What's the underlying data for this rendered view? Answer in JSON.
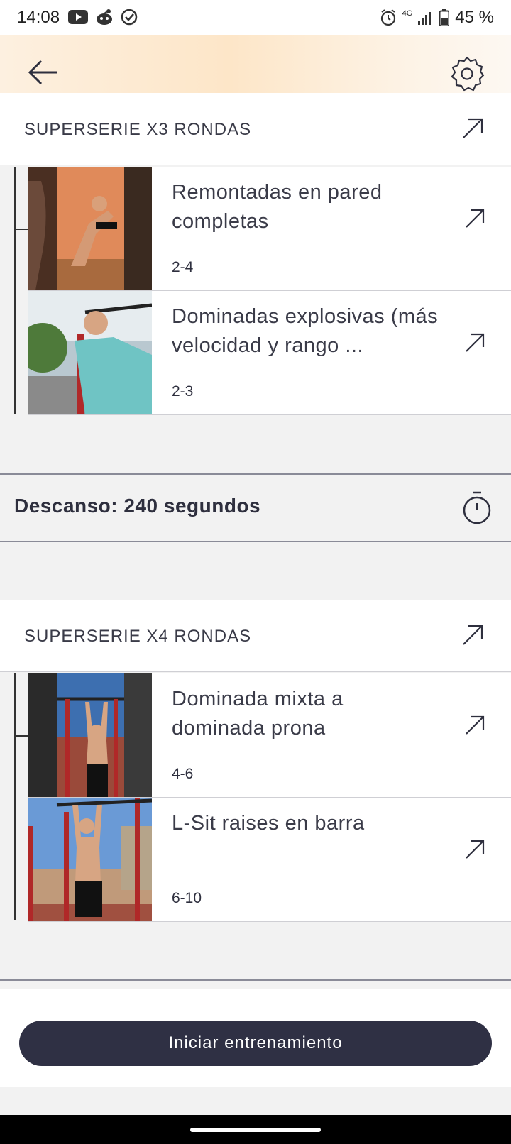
{
  "status_bar": {
    "time": "14:08",
    "battery": "45 %",
    "network": "4G",
    "icons": [
      "youtube-icon",
      "reddit-icon",
      "check-circle-icon",
      "alarm-icon",
      "signal-icon",
      "battery-icon"
    ]
  },
  "header": {
    "back_icon": "back-arrow-icon",
    "settings_icon": "gear-icon"
  },
  "sections": [
    {
      "title": "SUPERSERIE X3 RONDAS",
      "exercises": [
        {
          "name": "Remontadas en pared completas",
          "reps": "2-4"
        },
        {
          "name": "Dominadas explosivas (más velocidad y rango ...",
          "reps": "2-3"
        }
      ]
    },
    {
      "title": "SUPERSERIE X4 RONDAS",
      "exercises": [
        {
          "name": "Dominada mixta a dominada prona",
          "reps": "4-6"
        },
        {
          "name": "L-Sit raises en barra",
          "reps": "6-10"
        }
      ]
    }
  ],
  "rest": {
    "label": "Descanso: 240 segundos",
    "icon": "stopwatch-icon"
  },
  "start_button": {
    "label": "Iniciar entrenamiento"
  },
  "colors": {
    "primary_dark": "#2f3044",
    "divider": "#8a8b98",
    "header_gradient_peach": "#fde6c8"
  }
}
